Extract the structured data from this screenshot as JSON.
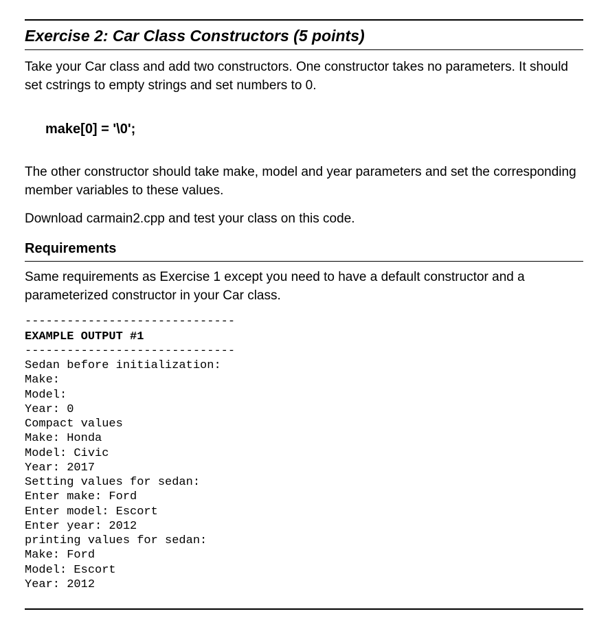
{
  "title": "Exercise 2: Car Class Constructors (5 points)",
  "para1": "Take your Car class and add two constructors.  One constructor takes no parameters. It should set cstrings to empty strings and set numbers to 0.",
  "code_line": "make[0] = '\\0';",
  "para2": "The other constructor should take make, model and year parameters and set the corresponding member variables to these values.",
  "para3": "Download carmain2.cpp and test your class on this code.",
  "requirements_heading": "Requirements",
  "requirements_body": "Same requirements as Exercise 1 except you need to have a default constructor and a parameterized constructor in your Car class.",
  "example": {
    "rule": "------------------------------",
    "header": "EXAMPLE OUTPUT #1",
    "lines": [
      "Sedan before initialization:",
      "Make:",
      "Model:",
      "Year: 0",
      "Compact values",
      "Make: Honda",
      "Model: Civic",
      "Year: 2017",
      "Setting values for sedan:",
      "Enter make: Ford",
      "Enter model: Escort",
      "Enter year: 2012",
      "printing values for sedan:",
      "Make: Ford",
      "Model: Escort",
      "Year: 2012"
    ]
  }
}
